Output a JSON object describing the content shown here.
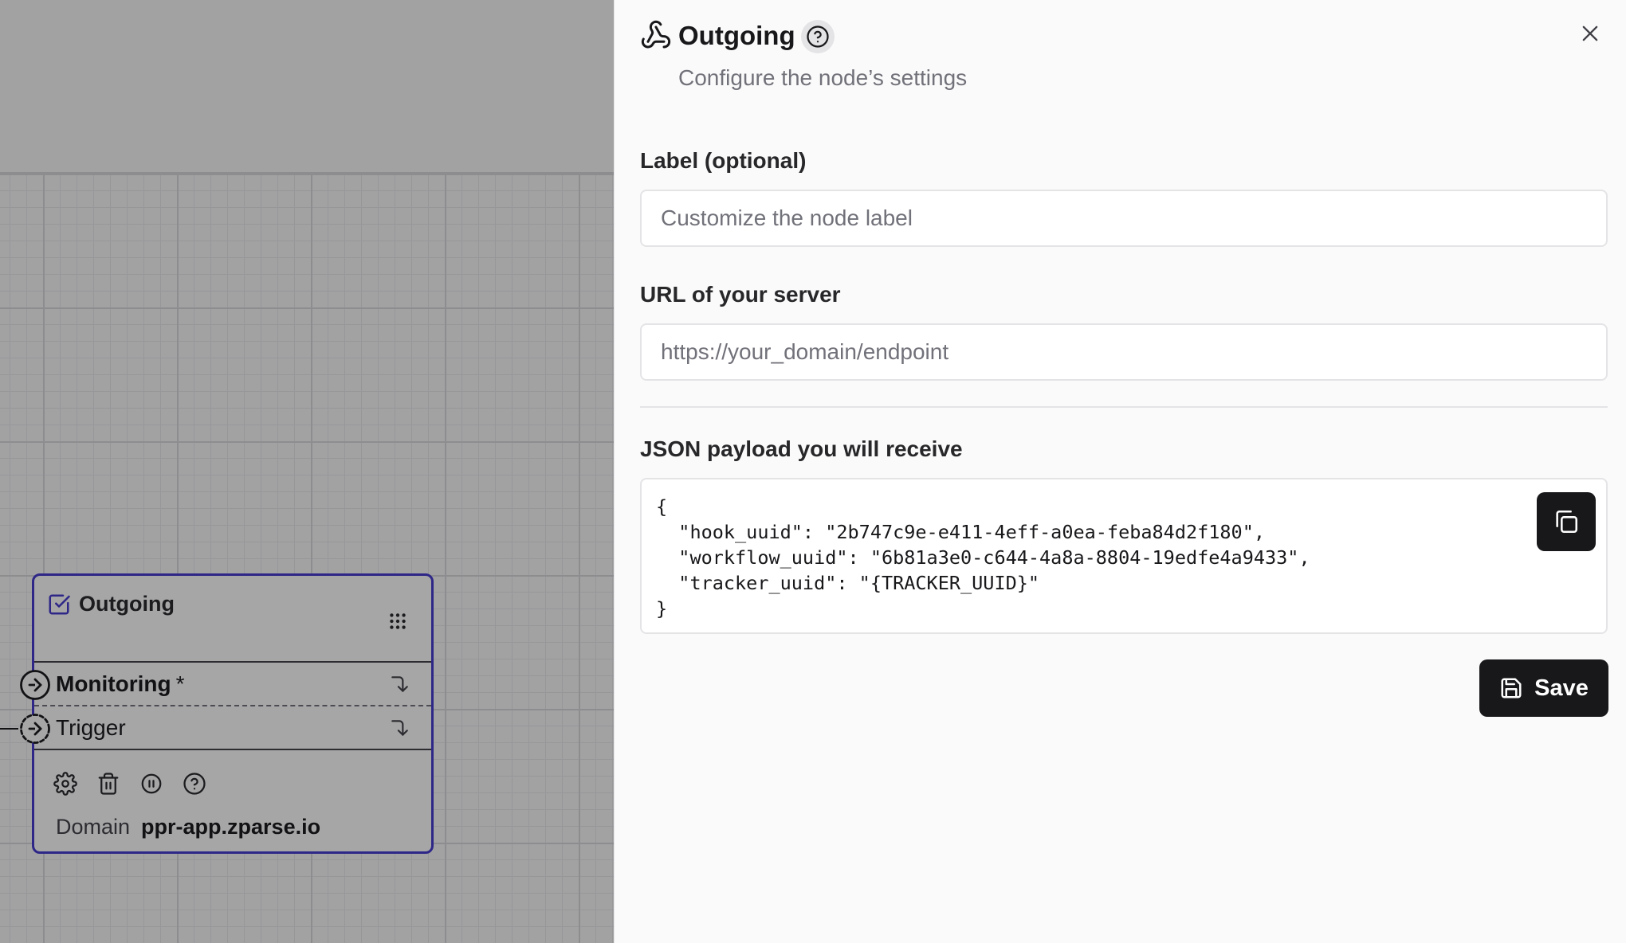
{
  "canvas": {
    "node": {
      "title": "Outgoing",
      "ports": [
        {
          "label": "Monitoring",
          "required_mark": "*"
        },
        {
          "label": "Trigger"
        }
      ],
      "actions": [
        "gear-icon",
        "trash-icon",
        "pause-icon",
        "help-circle-icon"
      ],
      "domain_label": "Domain",
      "domain_value": "ppr-app.zparse.io"
    }
  },
  "sheet": {
    "icon": "webhook-icon",
    "title": "Outgoing",
    "description": "Configure the node’s settings",
    "label_field": {
      "label": "Label (optional)",
      "value": "",
      "placeholder": "Customize the node label"
    },
    "url_field": {
      "label": "URL of your server",
      "value": "",
      "placeholder": "https://your_domain/endpoint"
    },
    "payload": {
      "label": "JSON payload you will receive",
      "code": "{\n  \"hook_uuid\": \"2b747c9e-e411-4eff-a0ea-feba84d2f180\",\n  \"workflow_uuid\": \"6b81a3e0-c644-4a8a-8804-19edfe4a9433\",\n  \"tracker_uuid\": \"{TRACKER_UUID}\"\n}"
    },
    "save_label": "Save"
  },
  "colors": {
    "node_border": "#4338ca",
    "primary_button": "#18181b",
    "muted_text": "#71717a"
  }
}
